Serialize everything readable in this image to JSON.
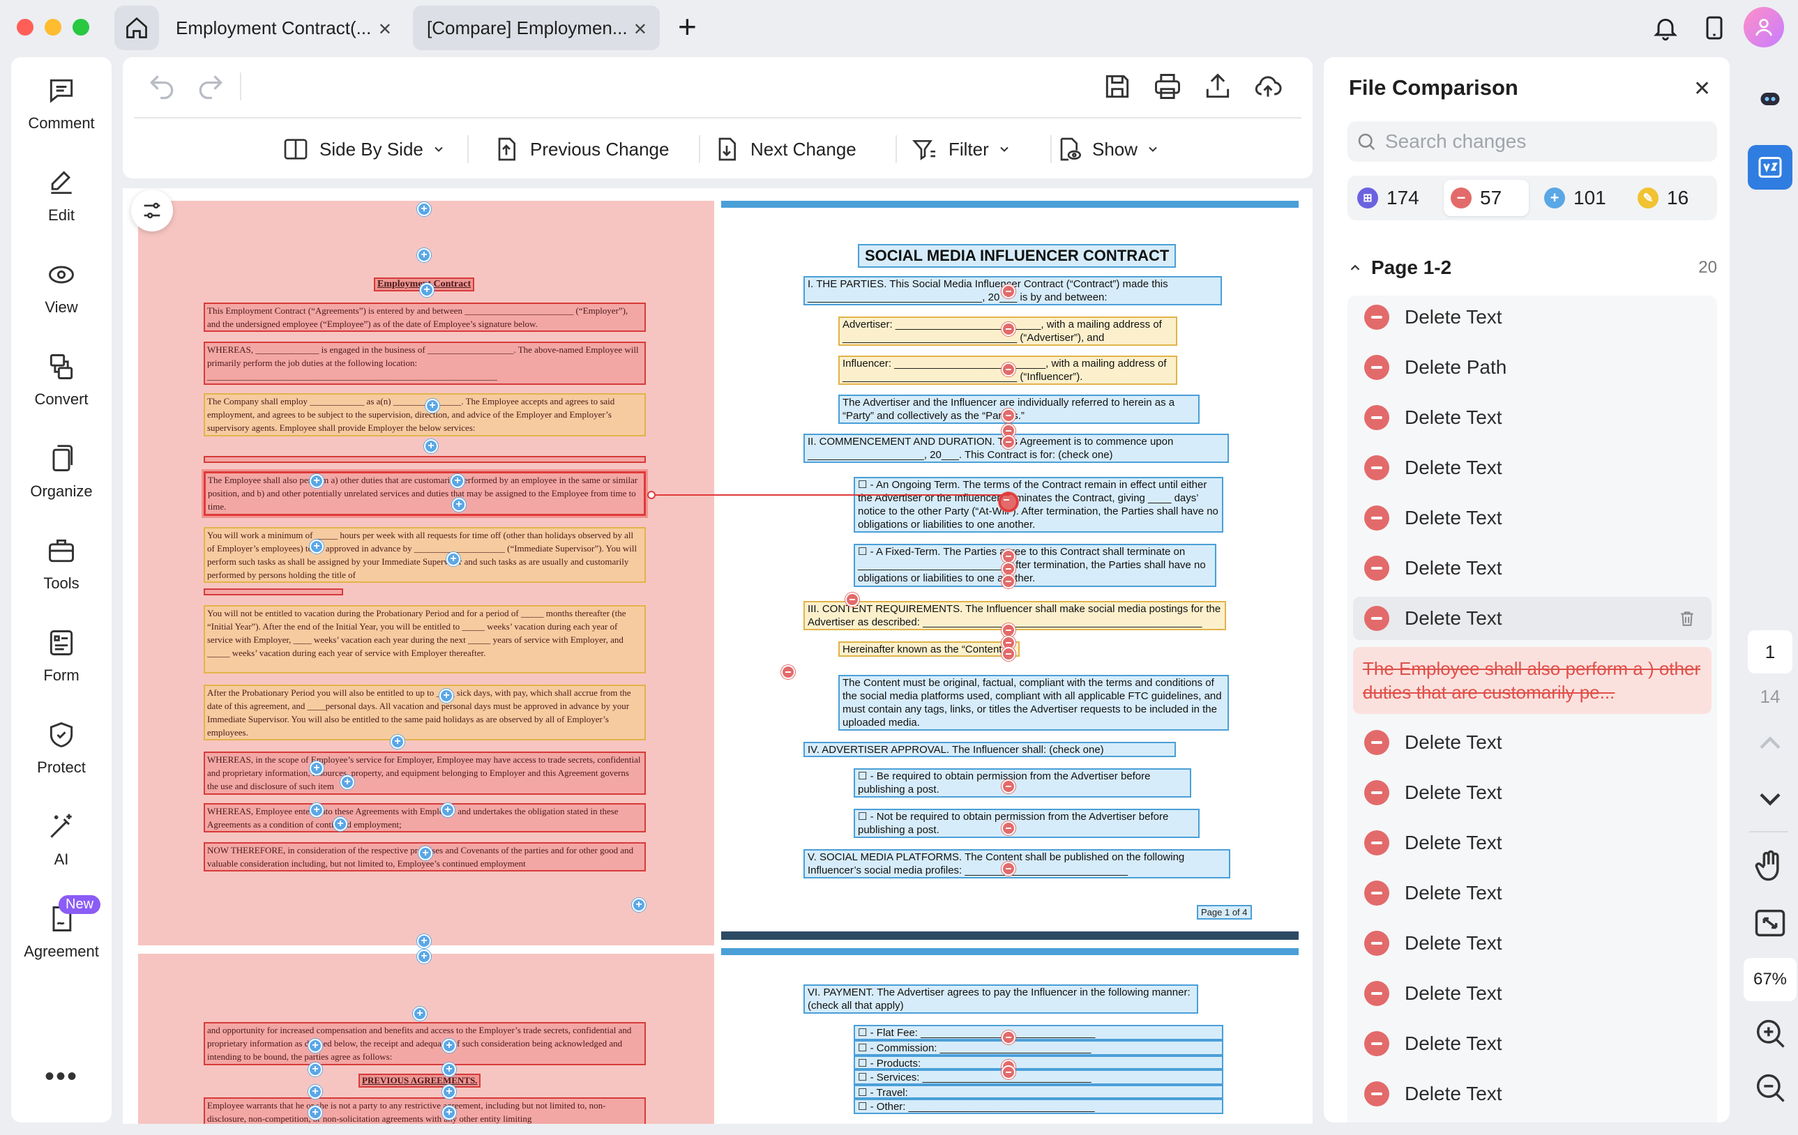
{
  "titlebar": {
    "tabs": [
      {
        "label": "Employment Contract(..."
      },
      {
        "label": "[Compare] Employmen..."
      }
    ],
    "new_tab": "+"
  },
  "left_sidebar": {
    "items": [
      {
        "label": "Comment",
        "icon": "comment-icon"
      },
      {
        "label": "Edit",
        "icon": "edit-icon"
      },
      {
        "label": "View",
        "icon": "view-icon"
      },
      {
        "label": "Convert",
        "icon": "convert-icon"
      },
      {
        "label": "Organize",
        "icon": "organize-icon"
      },
      {
        "label": "Tools",
        "icon": "tools-icon"
      },
      {
        "label": "Form",
        "icon": "form-icon"
      },
      {
        "label": "Protect",
        "icon": "protect-icon"
      },
      {
        "label": "AI",
        "icon": "ai-wand-icon"
      },
      {
        "label": "Agreement",
        "icon": "agreement-icon",
        "badge": "New"
      }
    ],
    "more": "•••"
  },
  "toolbar": {
    "side_by_side": "Side By Side",
    "previous_change": "Previous Change",
    "next_change": "Next Change",
    "filter": "Filter",
    "show": "Show"
  },
  "document": {
    "left": {
      "title": "Employment Contract",
      "p1": "This Employment Contract (“Agreements”) is entered by and between ________________________ (“Employer”), and the undersigned employee (“Employee”) as of the date of Employee’s signature below.",
      "p2": "WHEREAS, ______________ is engaged in the business of ___________________. The above-named Employee will primarily perform the job duties at the following location: ________________________________________________________________",
      "p3": "The Company shall employ ____________ as a(n) _______________. The Employee accepts and agrees to said employment, and agrees to be subject to the supervision, direction, and advice of the Employer and Employer’s supervisory agents. Employee shall provide Employer the below services:",
      "p4": "The Employee shall also perform a) other duties that are customarily performed by an employee in the same or similar position, and b) and other potentially unrelated services and duties that may be assigned to the Employee from time to time.",
      "p5": "You will work a minimum of _____ hours per week with all requests for time off (other than holidays observed by all of Employer’s employees) to be approved in advance by ____________________ (“Immediate Supervisor”). You will perform such tasks as shall be assigned by your Immediate Supervisor and such tasks as are usually and customarily performed by persons holding the title of",
      "p6": "You will not be entitled to vacation during the Probationary Period and for a period of _____ months thereafter (the “Initial Year”). After the end of the Initial Year, you will be entitled to _____ weeks’ vacation during each year of service with Employer, ____ weeks’ vacation each year during the next _____ years of service with Employer, and _____ weeks’ vacation during each year of service with Employer thereafter.",
      "p7": "After the Probationary Period you will also be entitled to up to ____ sick days, with pay, which shall accrue from the date of this agreement, and ____personal days. All vacation and personal days must be approved in advance by your Immediate Supervisor. You will also be entitled to the same paid holidays as are observed by all of Employer’s employees.",
      "p8": "WHEREAS, in the scope of Employee’s service for Employer, Employee may have access to trade secrets, confidential and proprietary information, resources, property, and equipment belonging to Employer and this Agreement governs the use and disclosure of such item",
      "p9": "WHEREAS, Employee enters into these Agreements with Employer and undertakes the obligation stated in these Agreements as a condition of continued employment;",
      "p10": "NOW THEREFORE, in consideration of the respective promises and Covenants of the parties and for other good and valuable consideration including, but not limited to, Employee’s continued employment",
      "p11": "and opportunity for increased compensation and benefits and access to the Employer’s trade secrets, confidential and proprietary information as defined below, the receipt and adequacy of such consideration being acknowledged and intending to be bound, the parties agree as follows:",
      "title2": "PREVIOUS AGREEMENTS.",
      "p12": "Employee warrants that he or she is not a party to any restrictive agreement, including but not limited to, non-disclosure, non-competition, or non-solicitation agreements with any other entity limiting"
    },
    "right": {
      "title": "SOCIAL MEDIA INFLUENCER CONTRACT",
      "s1": "I.     THE PARTIES. This Social Media Influencer Contract (“Contract”) made this ______________________________, 20___ is by and between:",
      "adv": "Advertiser: _________________________, with a mailing address of ______________________________ (“Advertiser”), and",
      "inf": "Influencer: __________________________, with a mailing address of ______________________________ (“Influencer”).",
      "party": "The Advertiser and the Influencer are individually referred to herein as a “Party” and collectively as the “Parties.”",
      "s2": "II.    COMMENCEMENT AND DURATION. This Agreement is to commence upon ____________________, 20___. This Contract is for: (check one)",
      "ongoing": "☐ - An Ongoing Term. The terms of the Contract remain in effect until either the Advertiser or the Influencer terminates the Contract, giving ____ days’ notice to the other Party (“At-Will”). After termination, the Parties shall have no obligations or liabilities to one another.",
      "fixed": "☐ - A Fixed-Term. The Parties agree to this Contract shall terminate on _________________________. After termination, the Parties shall have no obligations or liabilities to one another.",
      "s3": "III.   CONTENT REQUIREMENTS. The Influencer shall make social media postings for the Advertiser as described: ________________________________________________",
      "known": "Hereinafter known as the “Content.”",
      "content": "The Content must be original, factual, compliant with the terms and conditions of the social media platforms used, compliant with all applicable FTC guidelines, and must contain any tags, links, or titles the Advertiser requests to be included in the uploaded media.",
      "s4": "IV.   ADVERTISER APPROVAL. The Influencer shall: (check one)",
      "req": "☐ - Be required to obtain permission from the Advertiser before publishing a post.",
      "notreq": "☐ - Not be required to obtain permission from the Advertiser before publishing a post.",
      "s5": "V.    SOCIAL MEDIA PLATFORMS. The Content shall be published on the following Influencer’s social media profiles: ____________________________",
      "pagenum": "Page 1 of 4",
      "s6": "VI.   PAYMENT. The Advertiser agrees to pay the Influencer in the following manner: (check all that apply)",
      "pay": [
        "☐ - Flat Fee: ______________________________",
        "☐ - Commission: __________________________",
        "☐ - Products: _____________________________",
        "☐ - Services: _____________________________",
        "☐ - Travel: _______________________________",
        "☐ - Other: ________________________________"
      ]
    }
  },
  "comparison": {
    "title": "File Comparison",
    "search_placeholder": "Search changes",
    "stats": {
      "all": "174",
      "deleted": "57",
      "inserted": "101",
      "replaced": "16"
    },
    "group": {
      "label": "Page 1-2",
      "count": "20"
    },
    "changes": [
      "Delete Text",
      "Delete Path",
      "Delete Text",
      "Delete Text",
      "Delete Text",
      "Delete Text",
      "Delete Text",
      "Delete Text",
      "Delete Text",
      "Delete Text",
      "Delete Text",
      "Delete Text",
      "Delete Text",
      "Delete Text",
      "Delete Text"
    ],
    "preview": "The Employee shall also perform a ) other duties that are customarily pe..."
  },
  "rail": {
    "current_page": "1",
    "total_pages": "14",
    "zoom": "67%"
  },
  "colors": {
    "delete": "#e36a6a",
    "insert": "#5aa7e6",
    "replace": "#f1c232",
    "accent": "#2f7de1"
  }
}
